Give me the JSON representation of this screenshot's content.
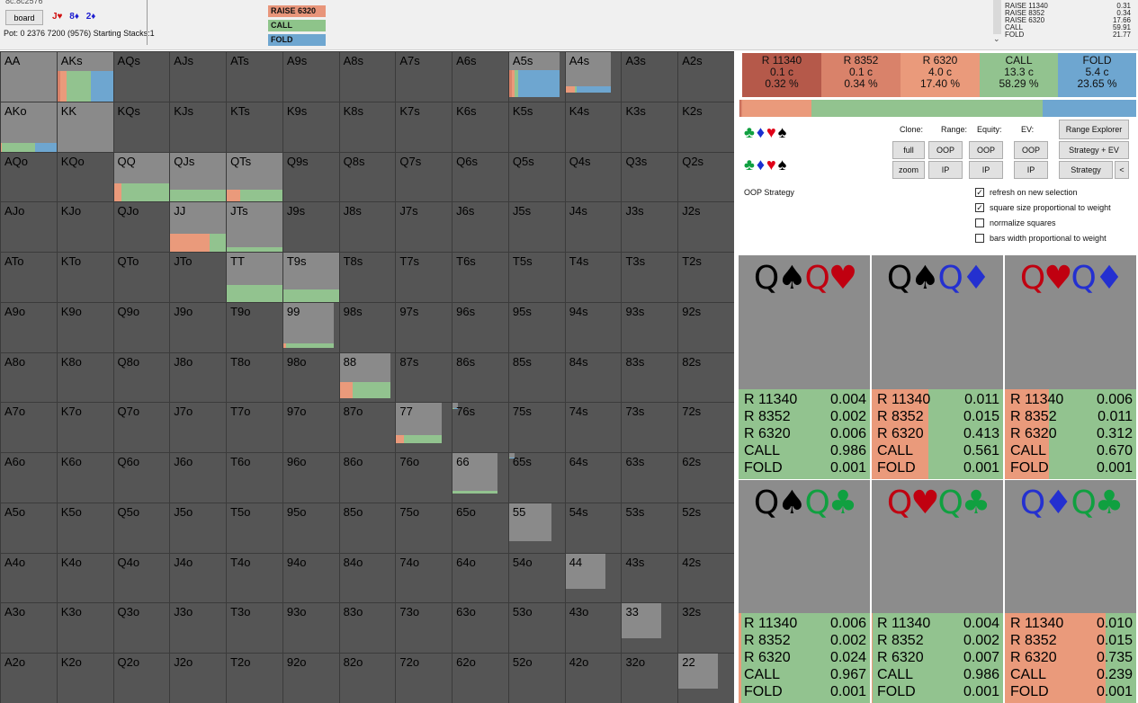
{
  "topbar": {
    "header_id": "8c.8c2576",
    "board_button": "board",
    "board_cards": [
      {
        "text": "J♥",
        "color": "#d01010"
      },
      {
        "text": "8♦",
        "color": "#2020d0"
      },
      {
        "text": "2♦",
        "color": "#2020d0"
      }
    ],
    "pot_line": "Pot: 0 2376 7200 (9576) Starting Stacks:1",
    "legend": [
      {
        "label": "RAISE 6320",
        "color": "#e8957a"
      },
      {
        "label": "CALL",
        "color": "#8ec48a"
      },
      {
        "label": "FOLD",
        "color": "#6ea6d0"
      }
    ],
    "dropdown_arrow": "⌄",
    "action_stats": [
      {
        "label": "RAISE 11340",
        "value": "0.31"
      },
      {
        "label": "RAISE 8352",
        "value": "0.34"
      },
      {
        "label": "RAISE 6320",
        "value": "17.66"
      },
      {
        "label": "CALL",
        "value": "59.91"
      },
      {
        "label": "FOLD",
        "value": "21.77"
      }
    ]
  },
  "colors": {
    "raise_big": "#b5594a",
    "raise_mid": "#d9826a",
    "raise_small": "#ea9a7b",
    "call": "#92c38f",
    "fold": "#6ea6d0",
    "grid_bg": "#555555",
    "weight": "#8a8a8a"
  },
  "grid": {
    "rows": [
      [
        "AA",
        "AKs",
        "AQs",
        "AJs",
        "ATs",
        "A9s",
        "A8s",
        "A7s",
        "A6s",
        "A5s",
        "A4s",
        "A3s",
        "A2s"
      ],
      [
        "AKo",
        "KK",
        "KQs",
        "KJs",
        "KTs",
        "K9s",
        "K8s",
        "K7s",
        "K6s",
        "K5s",
        "K4s",
        "K3s",
        "K2s"
      ],
      [
        "AQo",
        "KQo",
        "QQ",
        "QJs",
        "QTs",
        "Q9s",
        "Q8s",
        "Q7s",
        "Q6s",
        "Q5s",
        "Q4s",
        "Q3s",
        "Q2s"
      ],
      [
        "AJo",
        "KJo",
        "QJo",
        "JJ",
        "JTs",
        "J9s",
        "J8s",
        "J7s",
        "J6s",
        "J5s",
        "J4s",
        "J3s",
        "J2s"
      ],
      [
        "ATo",
        "KTo",
        "QTo",
        "JTo",
        "TT",
        "T9s",
        "T8s",
        "T7s",
        "T6s",
        "T5s",
        "T4s",
        "T3s",
        "T2s"
      ],
      [
        "A9o",
        "K9o",
        "Q9o",
        "J9o",
        "T9o",
        "99",
        "98s",
        "97s",
        "96s",
        "95s",
        "94s",
        "93s",
        "92s"
      ],
      [
        "A8o",
        "K8o",
        "Q8o",
        "J8o",
        "T8o",
        "98o",
        "88",
        "87s",
        "86s",
        "85s",
        "84s",
        "83s",
        "82s"
      ],
      [
        "A7o",
        "K7o",
        "Q7o",
        "J7o",
        "T7o",
        "97o",
        "87o",
        "77",
        "76s",
        "75s",
        "74s",
        "73s",
        "72s"
      ],
      [
        "A6o",
        "K6o",
        "Q6o",
        "J6o",
        "T6o",
        "96o",
        "86o",
        "76o",
        "66",
        "65s",
        "64s",
        "63s",
        "62s"
      ],
      [
        "A5o",
        "K5o",
        "Q5o",
        "J5o",
        "T5o",
        "95o",
        "85o",
        "75o",
        "65o",
        "55",
        "54s",
        "53s",
        "52s"
      ],
      [
        "A4o",
        "K4o",
        "Q4o",
        "J4o",
        "T4o",
        "94o",
        "84o",
        "74o",
        "64o",
        "54o",
        "44",
        "43s",
        "42s"
      ],
      [
        "A3o",
        "K3o",
        "Q3o",
        "J3o",
        "T3o",
        "93o",
        "83o",
        "73o",
        "63o",
        "53o",
        "43o",
        "33",
        "32s"
      ],
      [
        "A2o",
        "K2o",
        "Q2o",
        "J2o",
        "T2o",
        "92o",
        "82o",
        "72o",
        "62o",
        "52o",
        "42o",
        "32o",
        "22"
      ]
    ],
    "hands": {
      "AA": {
        "weight": 1.0,
        "fill": 0.0,
        "mix": []
      },
      "AKs": {
        "weight": 1.0,
        "fill": 0.62,
        "mix": [
          [
            "raise_mid",
            0.05
          ],
          [
            "raise_small",
            0.12
          ],
          [
            "call",
            0.42
          ],
          [
            "fold",
            0.41
          ]
        ]
      },
      "AKo": {
        "weight": 1.0,
        "fill": 0.18,
        "mix": [
          [
            "raise_small",
            0.02
          ],
          [
            "call",
            0.58
          ],
          [
            "fold",
            0.4
          ]
        ]
      },
      "KK": {
        "weight": 1.0,
        "fill": 0.0,
        "mix": []
      },
      "QQ": {
        "weight": 1.0,
        "fill": 0.38,
        "mix": [
          [
            "raise_small",
            0.14
          ],
          [
            "call",
            0.86
          ]
        ]
      },
      "QJs": {
        "weight": 1.0,
        "fill": 0.25,
        "mix": [
          [
            "call",
            1.0
          ]
        ]
      },
      "QTs": {
        "weight": 1.0,
        "fill": 0.25,
        "mix": [
          [
            "raise_small",
            0.24
          ],
          [
            "call",
            0.76
          ]
        ]
      },
      "JJ": {
        "weight": 1.0,
        "fill": 0.38,
        "mix": [
          [
            "raise_small",
            0.7
          ],
          [
            "call",
            0.3
          ]
        ]
      },
      "JTs": {
        "weight": 1.0,
        "fill": 0.1,
        "mix": [
          [
            "call",
            1.0
          ]
        ]
      },
      "TT": {
        "weight": 1.0,
        "fill": 0.35,
        "mix": [
          [
            "call",
            1.0
          ]
        ]
      },
      "T9s": {
        "weight": 1.0,
        "fill": 0.26,
        "mix": [
          [
            "call",
            1.0
          ]
        ]
      },
      "99": {
        "weight": 0.9,
        "fill": 0.1,
        "mix": [
          [
            "raise_small",
            0.05
          ],
          [
            "call",
            0.95
          ]
        ]
      },
      "88": {
        "weight": 0.9,
        "fill": 0.35,
        "mix": [
          [
            "raise_small",
            0.25
          ],
          [
            "call",
            0.75
          ]
        ]
      },
      "77": {
        "weight": 0.8,
        "fill": 0.2,
        "mix": [
          [
            "raise_small",
            0.18
          ],
          [
            "call",
            0.82
          ]
        ]
      },
      "76s": {
        "weight": 0.1,
        "fill": 0.08,
        "mix": [
          [
            "call",
            0.22
          ],
          [
            "fold",
            0.78
          ]
        ]
      },
      "66": {
        "weight": 0.8,
        "fill": 0.07,
        "mix": [
          [
            "call",
            1.0
          ]
        ]
      },
      "65s": {
        "weight": 0.1,
        "fill": 0.18,
        "mix": [
          [
            "call",
            0.1
          ],
          [
            "fold",
            0.9
          ]
        ]
      },
      "A5s": {
        "weight": 0.9,
        "fill": 0.6,
        "mix": [
          [
            "raise_mid",
            0.05
          ],
          [
            "raise_small",
            0.05
          ],
          [
            "call",
            0.08
          ],
          [
            "fold",
            0.82
          ]
        ]
      },
      "A4s": {
        "weight": 0.8,
        "fill": 0.15,
        "mix": [
          [
            "raise_small",
            0.2
          ],
          [
            "call",
            0.05
          ],
          [
            "fold",
            0.75
          ]
        ]
      },
      "55": {
        "weight": 0.75,
        "fill": 0.0,
        "mix": []
      },
      "44": {
        "weight": 0.7,
        "fill": 0.0,
        "mix": []
      },
      "33": {
        "weight": 0.7,
        "fill": 0.0,
        "mix": []
      },
      "22": {
        "weight": 0.7,
        "fill": 0.0,
        "mix": []
      }
    }
  },
  "right": {
    "actions": [
      {
        "name": "R 11340",
        "combos": "0.1 c",
        "pct": "0.32 %",
        "color": "#b5594a"
      },
      {
        "name": "R 8352",
        "combos": "0.1 c",
        "pct": "0.34 %",
        "color": "#d9826a"
      },
      {
        "name": "R 6320",
        "combos": "4.0 c",
        "pct": "17.40 %",
        "color": "#ea9a7b"
      },
      {
        "name": "CALL",
        "combos": "13.3 c",
        "pct": "58.29 %",
        "color": "#92c38f"
      },
      {
        "name": "FOLD",
        "combos": "5.4 c",
        "pct": "23.65 %",
        "color": "#6ea6d0"
      }
    ],
    "freq_bar": [
      {
        "action": "R 11340",
        "fraction": 0.0032,
        "color": "#b5594a"
      },
      {
        "action": "R 8352",
        "fraction": 0.0034,
        "color": "#d9826a"
      },
      {
        "action": "R 6320",
        "fraction": 0.174,
        "color": "#ea9a7b"
      },
      {
        "action": "CALL",
        "fraction": 0.5829,
        "color": "#92c38f"
      },
      {
        "action": "FOLD",
        "fraction": 0.2365,
        "color": "#6ea6d0"
      }
    ],
    "suit_rows": [
      [
        {
          "s": "♣",
          "c": "#10a040"
        },
        {
          "s": "♦",
          "c": "#1a2fd0"
        },
        {
          "s": "♥",
          "c": "#e00018"
        },
        {
          "s": "♠",
          "c": "#000000"
        }
      ],
      [
        {
          "s": "♣",
          "c": "#10a040"
        },
        {
          "s": "♦",
          "c": "#1a2fd0"
        },
        {
          "s": "♥",
          "c": "#e00018"
        },
        {
          "s": "♠",
          "c": "#000000"
        }
      ]
    ],
    "labels": {
      "clone": "Clone:",
      "range": "Range:",
      "equity": "Equity:",
      "ev": "EV:"
    },
    "buttons": {
      "full": "full",
      "zoom": "zoom",
      "range_oop": "OOP",
      "range_ip": "IP",
      "equity_oop": "OOP",
      "equity_ip": "IP",
      "ev_oop": "OOP",
      "ev_ip": "IP",
      "range_explorer": "Range Explorer",
      "strategy_ev": "Strategy + EV",
      "strategy": "Strategy",
      "collapse": "<"
    },
    "oop_strategy": "OOP Strategy",
    "options": [
      {
        "label": "refresh on new selection",
        "checked": true
      },
      {
        "label": "square size proportional to weight",
        "checked": true
      },
      {
        "label": "normalize squares",
        "checked": false
      },
      {
        "label": "bars width proportional to weight",
        "checked": false
      }
    ],
    "combos": [
      {
        "cards": [
          {
            "r": "Q",
            "s": "♠",
            "c": "#000000"
          },
          {
            "r": "Q",
            "s": "♥",
            "c": "#c00010"
          }
        ],
        "orange": 0.0,
        "rows": [
          [
            "R 11340",
            "0.004"
          ],
          [
            "R 8352",
            "0.002"
          ],
          [
            "R 6320",
            "0.006"
          ],
          [
            "CALL",
            "0.986"
          ],
          [
            "FOLD",
            "0.001"
          ]
        ]
      },
      {
        "cards": [
          {
            "r": "Q",
            "s": "♠",
            "c": "#000000"
          },
          {
            "r": "Q",
            "s": "♦",
            "c": "#2430d0"
          }
        ],
        "orange": 0.43,
        "rows": [
          [
            "R 11340",
            "0.011"
          ],
          [
            "R 8352",
            "0.015"
          ],
          [
            "R 6320",
            "0.413"
          ],
          [
            "CALL",
            "0.561"
          ],
          [
            "FOLD",
            "0.001"
          ]
        ]
      },
      {
        "cards": [
          {
            "r": "Q",
            "s": "♥",
            "c": "#c00010"
          },
          {
            "r": "Q",
            "s": "♦",
            "c": "#2430d0"
          }
        ],
        "orange": 0.33,
        "rows": [
          [
            "R 11340",
            "0.006"
          ],
          [
            "R 8352",
            "0.011"
          ],
          [
            "R 6320",
            "0.312"
          ],
          [
            "CALL",
            "0.670"
          ],
          [
            "FOLD",
            "0.001"
          ]
        ]
      },
      {
        "cards": [
          {
            "r": "Q",
            "s": "♠",
            "c": "#000000"
          },
          {
            "r": "Q",
            "s": "♣",
            "c": "#10a040"
          }
        ],
        "orange": 0.02,
        "rows": [
          [
            "R 11340",
            "0.006"
          ],
          [
            "R 8352",
            "0.002"
          ],
          [
            "R 6320",
            "0.024"
          ],
          [
            "CALL",
            "0.967"
          ],
          [
            "FOLD",
            "0.001"
          ]
        ]
      },
      {
        "cards": [
          {
            "r": "Q",
            "s": "♥",
            "c": "#c00010"
          },
          {
            "r": "Q",
            "s": "♣",
            "c": "#10a040"
          }
        ],
        "orange": 0.01,
        "rows": [
          [
            "R 11340",
            "0.004"
          ],
          [
            "R 8352",
            "0.002"
          ],
          [
            "R 6320",
            "0.007"
          ],
          [
            "CALL",
            "0.986"
          ],
          [
            "FOLD",
            "0.001"
          ]
        ]
      },
      {
        "cards": [
          {
            "r": "Q",
            "s": "♦",
            "c": "#2430d0"
          },
          {
            "r": "Q",
            "s": "♣",
            "c": "#10a040"
          }
        ],
        "orange": 0.76,
        "rows": [
          [
            "R 11340",
            "0.010"
          ],
          [
            "R 8352",
            "0.015"
          ],
          [
            "R 6320",
            "0.735"
          ],
          [
            "CALL",
            "0.239"
          ],
          [
            "FOLD",
            "0.001"
          ]
        ]
      }
    ]
  }
}
